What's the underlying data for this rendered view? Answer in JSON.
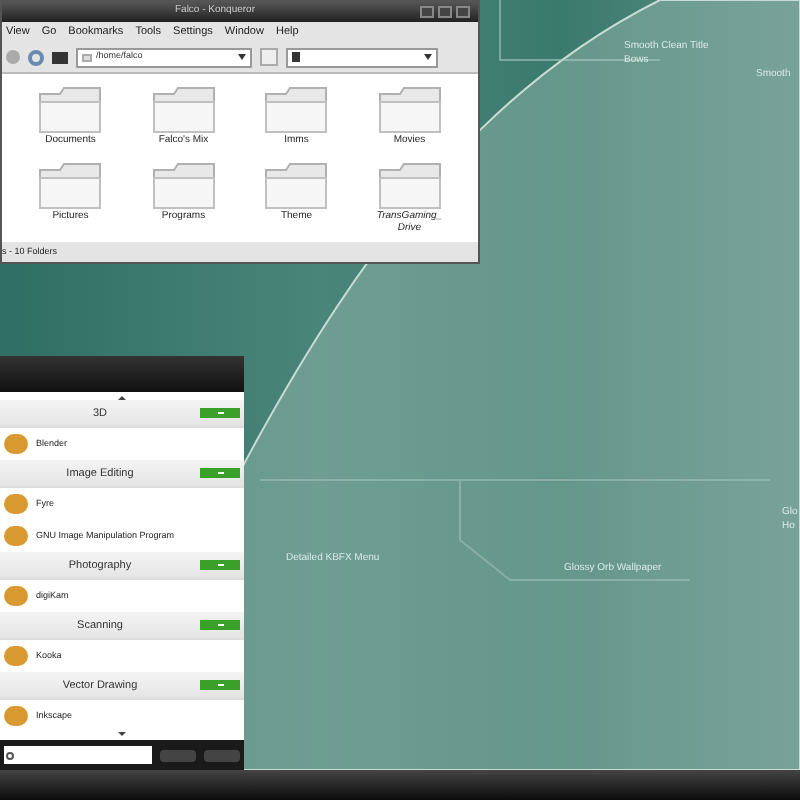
{
  "window": {
    "title": "Falco - Konqueror",
    "menu": [
      "View",
      "Go",
      "Bookmarks",
      "Tools",
      "Settings",
      "Window",
      "Help"
    ],
    "address": "/home/falco",
    "files": [
      {
        "name": "Documents",
        "link": false
      },
      {
        "name": "Falco's Mix",
        "link": false
      },
      {
        "name": "Imms",
        "link": false
      },
      {
        "name": "Movies",
        "link": false
      },
      {
        "name": "Pictures",
        "link": false
      },
      {
        "name": "Programs",
        "link": false
      },
      {
        "name": "Theme",
        "link": false
      },
      {
        "name": "TransGaming_ Drive",
        "link": true
      }
    ],
    "status_bar": "s - 10 Folders"
  },
  "wallpaper_labels": [
    "Smooth Clean Title Bows",
    "Smooth",
    "Detailed KBFX Menu",
    "Glossy Orb Wallpaper",
    "Glo",
    "Ho"
  ],
  "launcher_menu": {
    "items": [
      {
        "kind": "category",
        "label": "3D"
      },
      {
        "kind": "app",
        "label": "Blender"
      },
      {
        "kind": "category",
        "label": "Image Editing"
      },
      {
        "kind": "app",
        "label": "Fyre"
      },
      {
        "kind": "app",
        "label": "GNU Image Manipulation Program"
      },
      {
        "kind": "category",
        "label": "Photography"
      },
      {
        "kind": "app",
        "label": "digiKam"
      },
      {
        "kind": "category",
        "label": "Scanning"
      },
      {
        "kind": "app",
        "label": "Kooka"
      },
      {
        "kind": "category",
        "label": "Vector Drawing"
      },
      {
        "kind": "app",
        "label": "Inkscape"
      }
    ]
  }
}
